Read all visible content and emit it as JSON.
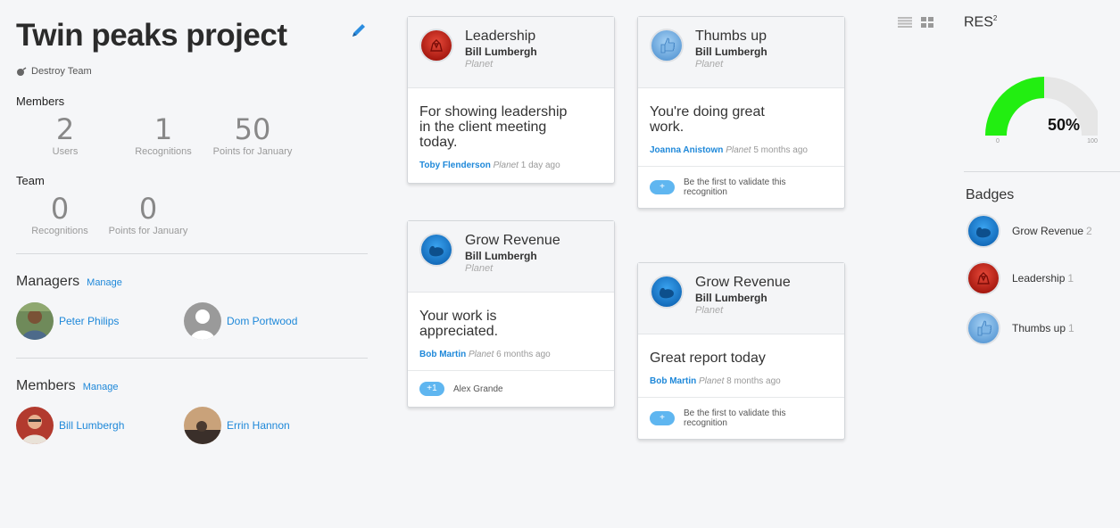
{
  "project": {
    "title": "Twin peaks project",
    "team_name": "Destroy Team"
  },
  "members_stats": {
    "label": "Members",
    "items": [
      {
        "value": "2",
        "label": "Users"
      },
      {
        "value": "1",
        "label": "Recognitions"
      },
      {
        "value": "50",
        "label": "Points for January"
      }
    ]
  },
  "team_stats": {
    "label": "Team",
    "items": [
      {
        "value": "0",
        "label": "Recognitions"
      },
      {
        "value": "0",
        "label": "Points for January"
      }
    ]
  },
  "managers": {
    "label": "Managers",
    "manage": "Manage",
    "people": [
      "Peter Philips",
      "Dom Portwood"
    ]
  },
  "members": {
    "label": "Members",
    "manage": "Manage",
    "people": [
      "Bill Lumbergh",
      "Errin Hannon"
    ]
  },
  "cards": [
    {
      "badge": "Leadership",
      "badge_icon": "leadership-icon",
      "giver": "Bill Lumbergh",
      "org": "Planet",
      "message": "For showing leadership in the client meeting today.",
      "recipient": "Toby Flenderson",
      "recipient_org": "Planet",
      "time": "1 day ago"
    },
    {
      "badge": "Grow Revenue",
      "badge_icon": "grow-revenue-icon",
      "giver": "Bill Lumbergh",
      "org": "Planet",
      "message": "Your work is appreciated.",
      "recipient": "Bob Martin",
      "recipient_org": "Planet",
      "time": "6 months ago",
      "validate_count": "+1",
      "validate_text": "Alex Grande"
    },
    {
      "badge": "Thumbs up",
      "badge_icon": "thumbs-up-icon",
      "giver": "Bill Lumbergh",
      "org": "Planet",
      "message": "You're doing great work.",
      "recipient": "Joanna Anistown",
      "recipient_org": "Planet",
      "time": "5 months ago",
      "validate_count": "+",
      "validate_text": "Be the first to validate this recognition"
    },
    {
      "badge": "Grow Revenue",
      "badge_icon": "grow-revenue-icon",
      "giver": "Bill Lumbergh",
      "org": "Planet",
      "message": "Great report today",
      "recipient": "Bob Martin",
      "recipient_org": "Planet",
      "time": "8 months ago",
      "validate_count": "+",
      "validate_text": "Be the first to validate this recognition"
    }
  ],
  "res": {
    "label": "RES",
    "sup": "2"
  },
  "gauge": {
    "value": 50,
    "label": "50%",
    "min": "0",
    "max": "100",
    "color_fill": "#22ee11",
    "color_track": "#e6e6e6"
  },
  "badges": {
    "title": "Badges",
    "items": [
      {
        "name": "Grow Revenue",
        "count": "2",
        "icon": "grow-revenue-icon"
      },
      {
        "name": "Leadership",
        "count": "1",
        "icon": "leadership-icon"
      },
      {
        "name": "Thumbs up",
        "count": "1",
        "icon": "thumbs-up-icon"
      }
    ]
  },
  "colors": {
    "link": "#1e88d9",
    "leadership": "#c62828",
    "grow": "#1e88d9",
    "thumbs": "#5a9fd8"
  }
}
